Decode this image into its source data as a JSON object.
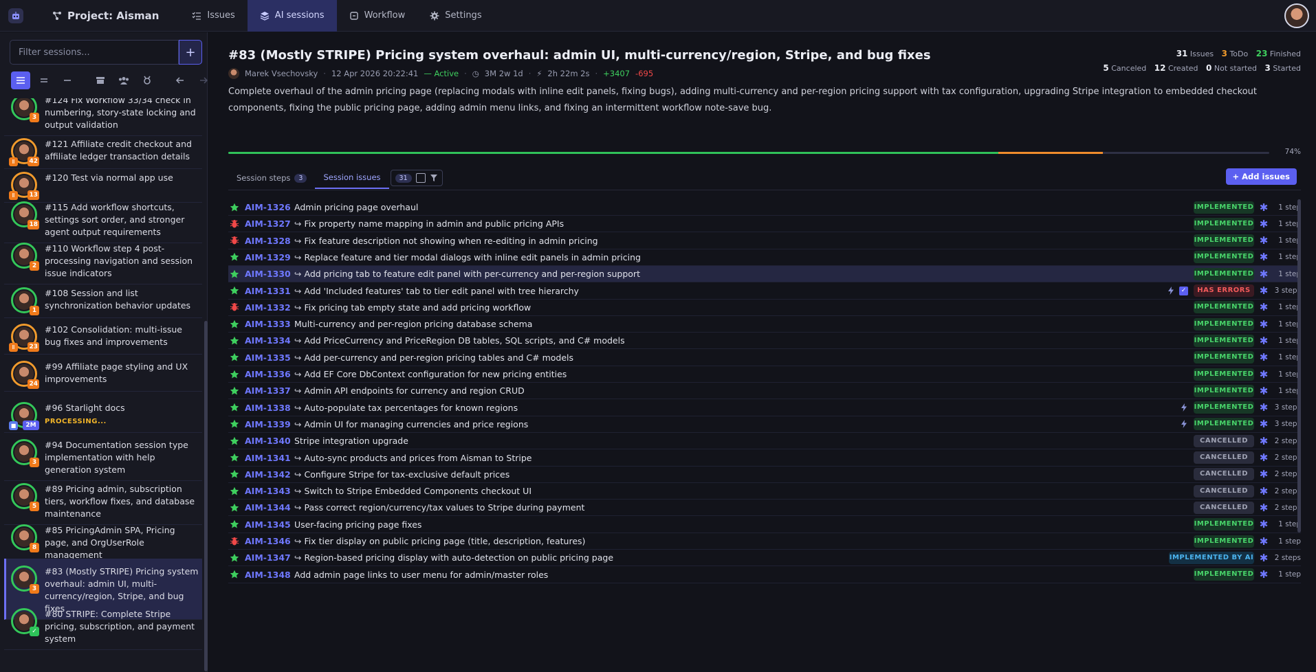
{
  "topbar": {
    "project": "Project: Aisman",
    "nav": [
      {
        "label": "Issues",
        "icon": "list-check-icon"
      },
      {
        "label": "AI sessions",
        "icon": "layers-icon",
        "active": true
      },
      {
        "label": "Workflow",
        "icon": "workflow-icon"
      },
      {
        "label": "Settings",
        "icon": "gear-icon"
      }
    ]
  },
  "sidebar": {
    "filter_placeholder": "Filter sessions...",
    "add_label": "+",
    "sessions": [
      {
        "title": "#124 Fix Workflow 33/34 check in numbering, story-state locking and output validation",
        "badge": "3",
        "ring": "green"
      },
      {
        "title": "#121 Affiliate credit checkout and affiliate ledger transaction details",
        "badge": "42",
        "ring": "orange",
        "paused": true
      },
      {
        "title": "#120 Test via normal app use",
        "badge": "13",
        "ring": "orange",
        "paused": true
      },
      {
        "title": "#115 Add workflow shortcuts, settings sort order, and stronger agent output requirements",
        "badge": "18",
        "ring": "green"
      },
      {
        "title": "#110 Workflow step 4 post-processing navigation and session issue indicators",
        "badge": "2",
        "ring": "green"
      },
      {
        "title": "#108 Session and list synchronization behavior updates",
        "badge": "1",
        "ring": "green"
      },
      {
        "title": "#102 Consolidation: multi-issue bug fixes and improvements",
        "badge": "23",
        "ring": "orange",
        "paused": true
      },
      {
        "title": "#99 Affiliate page styling and UX improvements",
        "badge": "24",
        "ring": "orange"
      },
      {
        "title": "#96 Starlight docs",
        "badge": "2M",
        "ring": "green",
        "processing": "PROCESSING..."
      },
      {
        "title": "#94 Documentation session type implementation with help generation system",
        "badge": "3",
        "ring": "green"
      },
      {
        "title": "#89 Pricing admin, subscription tiers, workflow fixes, and database maintenance",
        "badge": "5",
        "ring": "green"
      },
      {
        "title": "#85 PricingAdmin SPA, Pricing page, and OrgUserRole management",
        "badge": "8",
        "ring": "green"
      },
      {
        "title": "#83 (Mostly STRIPE) Pricing system overhaul: admin UI, multi-currency/region, Stripe, and bug fixes",
        "badge": "3",
        "ring": "green",
        "active": true
      },
      {
        "title": "#80 STRIPE: Complete Stripe pricing, subscription, and payment system",
        "badge": "✓",
        "ring": "green",
        "done": true
      }
    ]
  },
  "session": {
    "title": "#83 (Mostly STRIPE) Pricing system overhaul: admin UI, multi-currency/region, Stripe, and bug fixes",
    "author": "Marek Vsechovsky",
    "date": "12 Apr 2026 20:22:41",
    "status": "— Active",
    "duration": "3M 2w 1d",
    "ai_time": "2h 22m 2s",
    "additions": "+3407",
    "deletions": "-695",
    "description": "Complete overhaul of the admin pricing page (replacing modals with inline edit panels, fixing bugs), adding multi-currency and per-region pricing support with tax configuration, upgrading Stripe integration to embedded checkout components, fixing the public pricing page, adding admin menu links, and fixing an intermittent workflow note-save bug.",
    "stats": {
      "issues": "31",
      "issues_label": "Issues",
      "todo": "3",
      "todo_label": "ToDo",
      "finished": "23",
      "finished_label": "Finished",
      "canceled": "5",
      "canceled_label": "Canceled",
      "created": "12",
      "created_label": "Created",
      "not_started": "0",
      "not_started_label": "Not started",
      "started": "3",
      "started_label": "Started"
    },
    "progress": {
      "green": 0.74,
      "orange": 0.1,
      "label": "74%"
    },
    "tabs": {
      "steps_label": "Session steps",
      "steps_count": "3",
      "issues_label": "Session issues",
      "issues_count": "31"
    },
    "add_issues_label": "+ Add issues"
  },
  "issues": [
    {
      "key": "AIM-1326",
      "title": "Admin pricing page overhaul",
      "sub": false,
      "type": "star",
      "status": "IMPLEMENTED",
      "steps": "1 step"
    },
    {
      "key": "AIM-1327",
      "title": "Fix property name mapping in admin and public pricing APIs",
      "sub": true,
      "type": "bug",
      "status": "IMPLEMENTED",
      "steps": "1 step"
    },
    {
      "key": "AIM-1328",
      "title": "Fix feature description not showing when re-editing in admin pricing",
      "sub": true,
      "type": "bug",
      "status": "IMPLEMENTED",
      "steps": "1 step"
    },
    {
      "key": "AIM-1329",
      "title": "Replace feature and tier modal dialogs with inline edit panels in admin pricing",
      "sub": true,
      "type": "star",
      "status": "IMPLEMENTED",
      "steps": "1 step"
    },
    {
      "key": "AIM-1330",
      "title": "Add pricing tab to feature edit panel with per-currency and per-region support",
      "sub": true,
      "type": "star",
      "status": "IMPLEMENTED",
      "steps": "1 step",
      "highlight": true
    },
    {
      "key": "AIM-1331",
      "title": "Add 'Included features' tab to tier edit panel with tree hierarchy",
      "sub": true,
      "type": "star",
      "status": "HAS ERRORS",
      "steps": "3 steps",
      "bolt": true,
      "check": true
    },
    {
      "key": "AIM-1332",
      "title": "Fix pricing tab empty state and add pricing workflow",
      "sub": true,
      "type": "bug",
      "status": "IMPLEMENTED",
      "steps": "1 step"
    },
    {
      "key": "AIM-1333",
      "title": "Multi-currency and per-region pricing database schema",
      "sub": false,
      "type": "star",
      "status": "IMPLEMENTED",
      "steps": "1 step"
    },
    {
      "key": "AIM-1334",
      "title": "Add PriceCurrency and PriceRegion DB tables, SQL scripts, and C# models",
      "sub": true,
      "type": "star",
      "status": "IMPLEMENTED",
      "steps": "1 step"
    },
    {
      "key": "AIM-1335",
      "title": "Add per-currency and per-region pricing tables and C# models",
      "sub": true,
      "type": "star",
      "status": "IMPLEMENTED",
      "steps": "1 step"
    },
    {
      "key": "AIM-1336",
      "title": "Add EF Core DbContext configuration for new pricing entities",
      "sub": true,
      "type": "star",
      "status": "IMPLEMENTED",
      "steps": "1 step"
    },
    {
      "key": "AIM-1337",
      "title": "Admin API endpoints for currency and region CRUD",
      "sub": true,
      "type": "star",
      "status": "IMPLEMENTED",
      "steps": "1 step"
    },
    {
      "key": "AIM-1338",
      "title": "Auto-populate tax percentages for known regions",
      "sub": true,
      "type": "star",
      "status": "IMPLEMENTED",
      "steps": "3 steps",
      "bolt": true
    },
    {
      "key": "AIM-1339",
      "title": "Admin UI for managing currencies and price regions",
      "sub": true,
      "type": "star",
      "status": "IMPLEMENTED",
      "steps": "3 steps",
      "bolt": true
    },
    {
      "key": "AIM-1340",
      "title": "Stripe integration upgrade",
      "sub": false,
      "type": "star",
      "status": "CANCELLED",
      "steps": "2 steps"
    },
    {
      "key": "AIM-1341",
      "title": "Auto-sync products and prices from Aisman to Stripe",
      "sub": true,
      "type": "star",
      "status": "CANCELLED",
      "steps": "2 steps"
    },
    {
      "key": "AIM-1342",
      "title": "Configure Stripe for tax-exclusive default prices",
      "sub": true,
      "type": "star",
      "status": "CANCELLED",
      "steps": "2 steps"
    },
    {
      "key": "AIM-1343",
      "title": "Switch to Stripe Embedded Components checkout UI",
      "sub": true,
      "type": "star",
      "status": "CANCELLED",
      "steps": "2 steps"
    },
    {
      "key": "AIM-1344",
      "title": "Pass correct region/currency/tax values to Stripe during payment",
      "sub": true,
      "type": "star",
      "status": "CANCELLED",
      "steps": "2 steps"
    },
    {
      "key": "AIM-1345",
      "title": "User-facing pricing page fixes",
      "sub": false,
      "type": "star",
      "status": "IMPLEMENTED",
      "steps": "1 step"
    },
    {
      "key": "AIM-1346",
      "title": "Fix tier display on public pricing page (title, description, features)",
      "sub": true,
      "type": "bug",
      "status": "IMPLEMENTED",
      "steps": "1 step"
    },
    {
      "key": "AIM-1347",
      "title": "Region-based pricing display with auto-detection on public pricing page",
      "sub": true,
      "type": "star",
      "status": "IMPLEMENTED BY AI",
      "steps": "2 steps"
    },
    {
      "key": "AIM-1348",
      "title": "Add admin page links to user menu for admin/master roles",
      "sub": false,
      "type": "star",
      "status": "IMPLEMENTED",
      "steps": "1 step"
    }
  ],
  "colors": {
    "accent": "#5b5ff0",
    "green": "#3ecf5e",
    "orange": "#f09a2c",
    "red": "#f04848"
  }
}
